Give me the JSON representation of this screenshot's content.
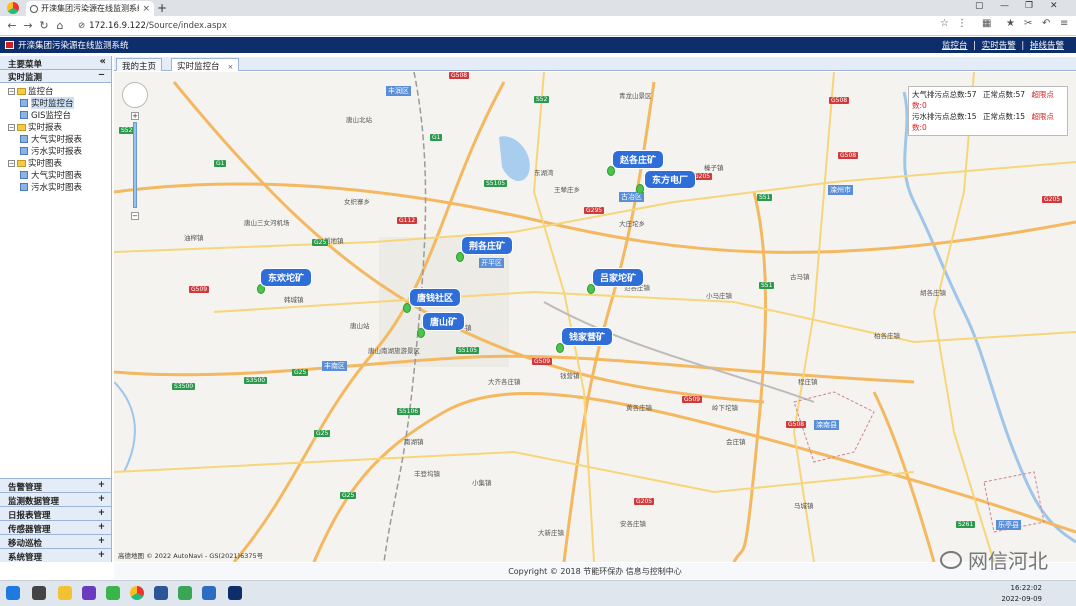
{
  "browser": {
    "tab_title": "开滦集团污染源在线监测系统",
    "url_host": "172.16.9.122",
    "url_path": "/Source/index.aspx"
  },
  "header": {
    "app_title": "开滦集团污染源在线监测系统",
    "link_monitor": "监控台",
    "link_alarm": "实时告警",
    "link_close_alarm": "掉线告警",
    "sep": "|"
  },
  "sidebar": {
    "title": "主要菜单",
    "collapse": "«",
    "section": "实时监测",
    "section_toggle": "−",
    "tree": [
      {
        "label": "监控台",
        "level": 0,
        "type": "folder"
      },
      {
        "label": "实时监控台",
        "level": 1,
        "type": "page",
        "selected": true
      },
      {
        "label": "GIS监控台",
        "level": 1,
        "type": "page"
      },
      {
        "label": "实时报表",
        "level": 0,
        "type": "folder"
      },
      {
        "label": "大气实时报表",
        "level": 1,
        "type": "page"
      },
      {
        "label": "污水实时报表",
        "level": 1,
        "type": "page"
      },
      {
        "label": "实时图表",
        "level": 0,
        "type": "folder"
      },
      {
        "label": "大气实时图表",
        "level": 1,
        "type": "page"
      },
      {
        "label": "污水实时图表",
        "level": 1,
        "type": "page"
      }
    ],
    "bottom_items": [
      "告警管理",
      "监测数据管理",
      "日报表管理",
      "传感器管理",
      "移动巡检",
      "系统管理"
    ],
    "plus": "+"
  },
  "content_tabs": {
    "home": "我的主页",
    "active": "实时监控台",
    "close": "×"
  },
  "map": {
    "info": {
      "air_label": "大气排污点总数:57",
      "air_normal": "正常点数:57",
      "air_exceed": "超限点数:0",
      "water_label": "污水排污点总数:15",
      "water_normal": "正常点数:15",
      "water_exceed": "超限点数:0"
    },
    "markers": [
      "赵各庄矿",
      "东方电厂",
      "荆各庄矿",
      "东欢坨矿",
      "唐钱社区",
      "唐山矿",
      "吕家坨矿",
      "钱家营矿"
    ],
    "districts": [
      "丰润区",
      "古冶区",
      "开平区",
      "丰南区",
      "滦州市",
      "滦南县",
      "乐亭县"
    ],
    "places": [
      "唐山北站",
      "唐山三女河机场",
      "唐山站",
      "唐山南湖旅游景区",
      "青龙山景区",
      "东湖湾",
      "王辇庄乡",
      "大庄坨乡",
      "范各庄镇",
      "稻地镇",
      "小马庄镇",
      "古马镇",
      "胡各庄镇",
      "程庄镇",
      "柏各庄镇",
      "开平镇",
      "女织寨乡",
      "韩城镇",
      "小集镇",
      "南湖镇",
      "大齐各庄镇",
      "钱营镇",
      "黄各庄镇",
      "丰登坞镇",
      "岭下坨镇",
      "会庄镇",
      "安各庄镇",
      "大新庄镇",
      "马城镇",
      "榛子镇",
      "油榨镇"
    ],
    "road_shields_red": [
      "G508",
      "G508",
      "G205",
      "G205",
      "G509",
      "G509",
      "G509",
      "G508",
      "G112",
      "G295",
      "G508",
      "G205"
    ],
    "road_shields_green": [
      "S52",
      "S52",
      "G1",
      "G1",
      "G25",
      "G25",
      "S5105",
      "S5105",
      "S5106",
      "S51",
      "S51",
      "G25",
      "S3500",
      "S3500",
      "G25",
      "S261"
    ],
    "footer": "高德地图 © 2022 AutoNavi - GS(2021)6375号"
  },
  "footer": {
    "copyright": "Copyright © 2018 节能环保办 信息与控制中心"
  },
  "watermark": "网信河北",
  "taskbar": {
    "time": "16:22:02",
    "date": "2022-09-09"
  }
}
